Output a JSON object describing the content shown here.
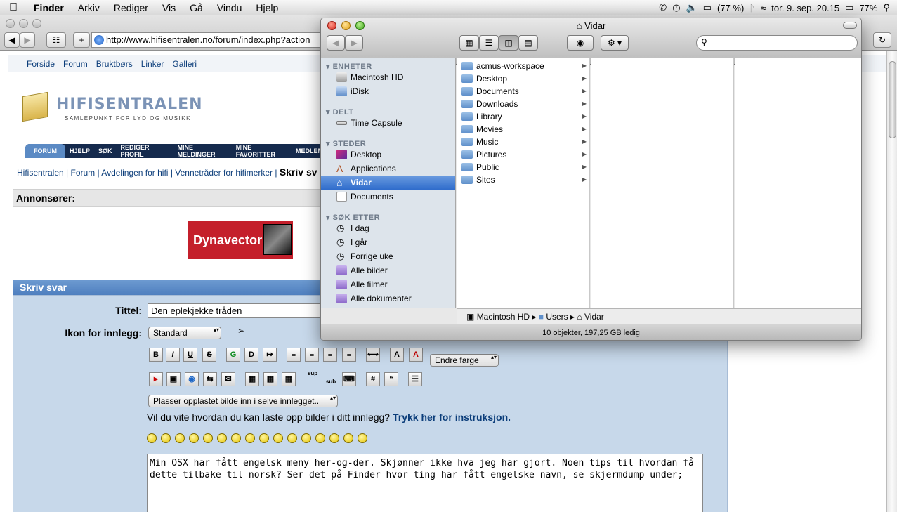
{
  "menubar": {
    "app": "Finder",
    "items": [
      "Arkiv",
      "Rediger",
      "Vis",
      "Gå",
      "Vindu",
      "Hjelp"
    ],
    "battery_small": "(77 %)",
    "datetime": "tor. 9. sep. 20.15",
    "battery": "77%"
  },
  "browser": {
    "url": "http://www.hifisentralen.no/forum/index.php?action"
  },
  "site": {
    "nav": [
      "Forside",
      "Forum",
      "Bruktbørs",
      "Linker",
      "Galleri"
    ],
    "logo_name": "HIFISENTRALEN",
    "logo_slogan": "SAMLEPUNKT FOR LYD OG MUSIKK",
    "tabs": [
      "FORUM",
      "HJELP",
      "SØK",
      "REDIGER PROFIL",
      "MINE MELDINGER",
      "MINE FAVORITTER",
      "MEDLEM"
    ],
    "breadcrumb": [
      "Hifisentralen",
      "Forum",
      "Avdelingen for hifi",
      "Vennetråder for hifimerker"
    ],
    "breadcrumb_current": "Skriv sv",
    "annons_label": "Annonsører:",
    "ad_text": "Dynavector",
    "skriv_header": "Skriv svar",
    "title_label": "Tittel:",
    "title_value": "Den eplekjekke tråden",
    "icon_label": "Ikon for innlegg:",
    "icon_select": "Standard",
    "color_select": "Endre farge",
    "upload_select": "Plasser opplastet bilde inn i selve innlegget..",
    "help_text": "Vil du vite hvordan du kan laste opp bilder i ditt innlegg?",
    "help_link": "Trykk her for instruksjon.",
    "message": "Min OSX har fått engelsk meny her-og-der. Skjønner ikke hva jeg har gjort. Noen tips til hvordan få dette tilbake til norsk? Ser det på Finder hvor ting har fått engelske navn, se skjermdump under;",
    "toolbar_b": "B",
    "toolbar_i": "I",
    "toolbar_u": "U",
    "toolbar_s": "S",
    "toolbar_sup": "sup",
    "toolbar_sub": "sub",
    "toolbar_hash": "#"
  },
  "finder": {
    "title": "Vidar",
    "sidebar": {
      "devices_header": "ENHETER",
      "devices": [
        "Macintosh HD",
        "iDisk"
      ],
      "shared_header": "DELT",
      "shared": [
        "Time Capsule"
      ],
      "places_header": "STEDER",
      "places": [
        "Desktop",
        "Applications",
        "Vidar",
        "Documents"
      ],
      "search_header": "SØK ETTER",
      "searches": [
        "I dag",
        "I går",
        "Forrige uke",
        "Alle bilder",
        "Alle filmer",
        "Alle dokumenter"
      ]
    },
    "column_items": [
      "acmus-workspace",
      "Desktop",
      "Documents",
      "Downloads",
      "Library",
      "Movies",
      "Music",
      "Pictures",
      "Public",
      "Sites"
    ],
    "path": [
      "Macintosh HD",
      "Users",
      "Vidar"
    ],
    "status": "10 objekter, 197,25 GB ledig"
  }
}
